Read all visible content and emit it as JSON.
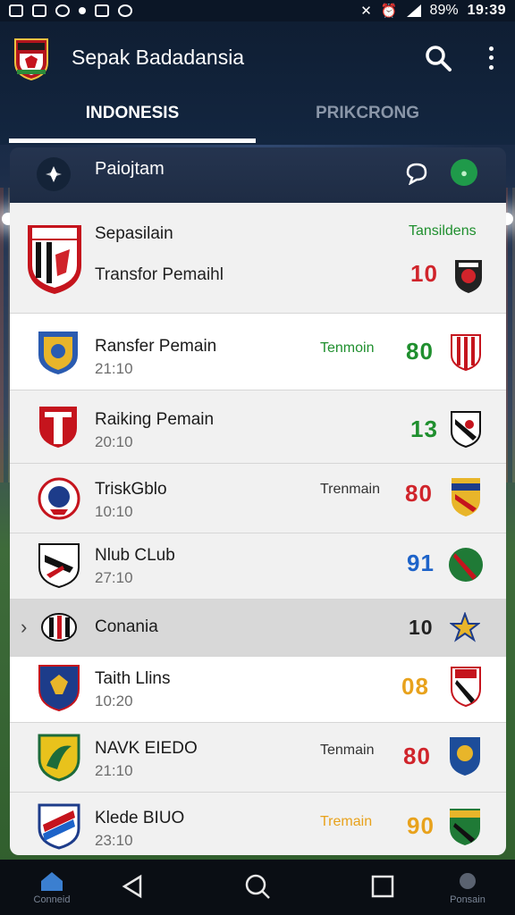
{
  "status_bar": {
    "battery": "89%",
    "time": "19:39"
  },
  "app_bar": {
    "title": "Sepak Badadansia"
  },
  "tabs": [
    {
      "label": "INDONESIS"
    },
    {
      "label": "PRIKCRONG"
    }
  ],
  "list_header": {
    "title": "Paiojtam"
  },
  "rows": [
    {
      "name": "Sepasilain",
      "sub": "Transfor Pemaihl",
      "label": "Tansildens",
      "score": "10",
      "label_color": "#1f8f2e",
      "score_color": "#d0242b"
    },
    {
      "name": "Ransfer Pemain",
      "sub": "21:10",
      "label": "Tenmoin",
      "score": "80",
      "label_color": "#1f8f2e",
      "score_color": "#1f8f2e"
    },
    {
      "name": "Raiking Pemain",
      "sub": "20:10",
      "label": "",
      "score": "13",
      "label_color": "#1f8f2e",
      "score_color": "#1f8f2e"
    },
    {
      "name": "TriskGblo",
      "sub": "10:10",
      "label": "Trenmain",
      "score": "80",
      "label_color": "#333333",
      "score_color": "#d0242b"
    },
    {
      "name": "Nlub CLub",
      "sub": "27:10",
      "label": "",
      "score": "91",
      "label_color": "#333333",
      "score_color": "#1d63c9"
    },
    {
      "name": "Conania",
      "sub": "",
      "label": "",
      "score": "10",
      "label_color": "#333333",
      "score_color": "#222222"
    },
    {
      "name": "Taith Llins",
      "sub": "10:20",
      "label": "",
      "score": "08",
      "label_color": "#333333",
      "score_color": "#e8a21c"
    },
    {
      "name": "NAVK EIEDO",
      "sub": "21:10",
      "label": "Tenmain",
      "score": "80",
      "label_color": "#333333",
      "score_color": "#d0242b"
    },
    {
      "name": "Klede BIUO",
      "sub": "23:10",
      "label": "Tremain",
      "score": "90",
      "label_color": "#e8a21c",
      "score_color": "#e8a21c"
    }
  ],
  "bottom_nav": [
    {
      "label": "Conneid"
    },
    {
      "label": ""
    },
    {
      "label": ""
    },
    {
      "label": ""
    },
    {
      "label": "Ponsain"
    }
  ]
}
